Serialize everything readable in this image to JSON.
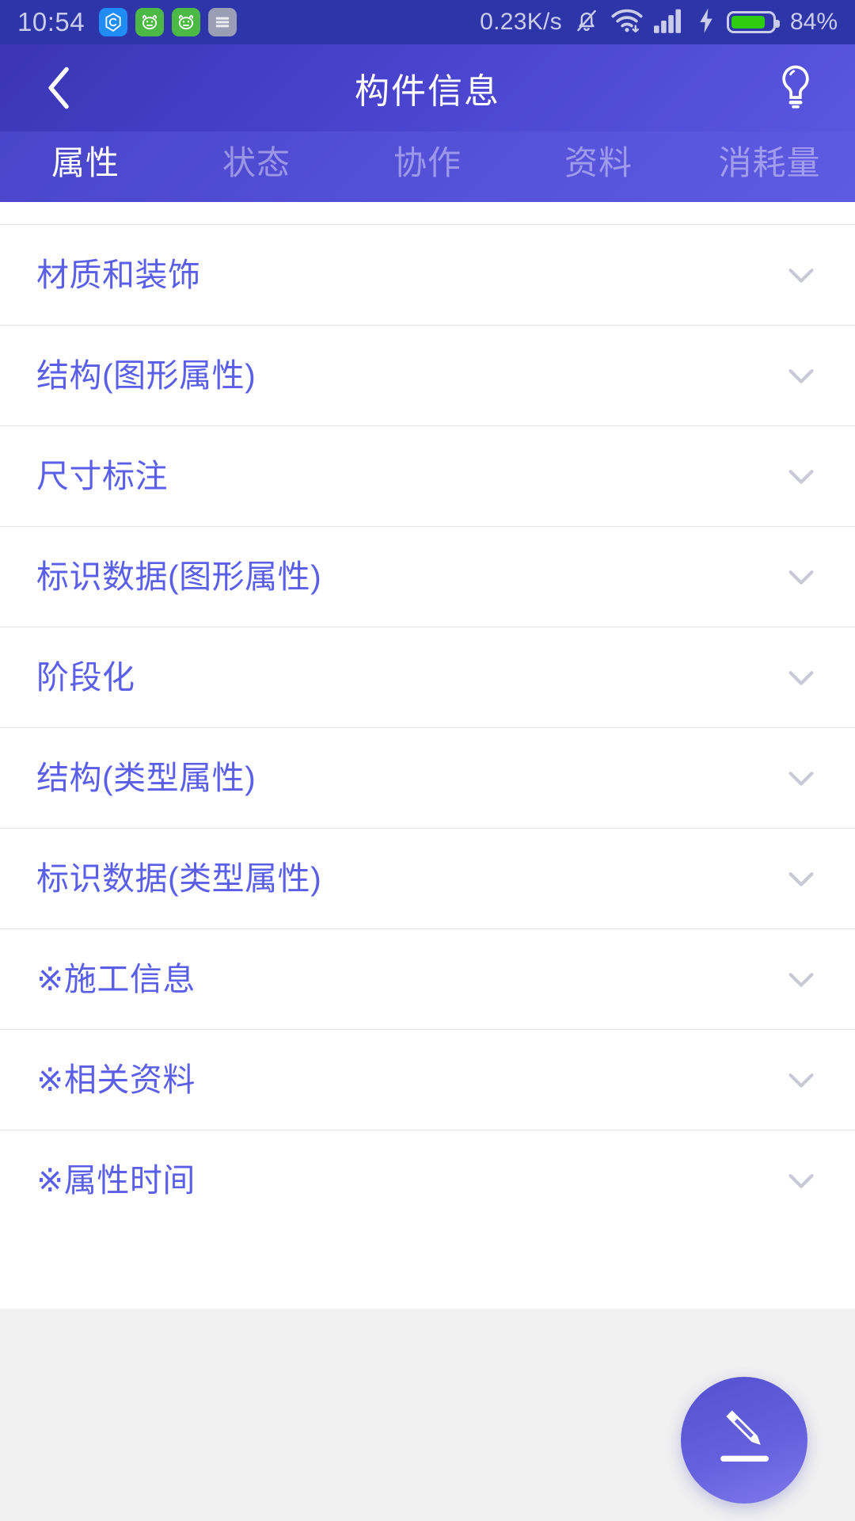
{
  "status_bar": {
    "time": "10:54",
    "network_speed": "0.23K/s",
    "battery_percent": "84%",
    "battery_level": 84,
    "app_icons": [
      {
        "name": "hexagon-app-icon",
        "color": "#1f8df5"
      },
      {
        "name": "frog-app-icon",
        "color": "#4cb944"
      },
      {
        "name": "frog-app-icon-2",
        "color": "#4cb944"
      },
      {
        "name": "list-app-icon",
        "color": "#9a9eb5"
      }
    ],
    "icons": [
      "mute-bell-icon",
      "wifi-icon",
      "cellular-signal-icon",
      "charging-bolt-icon",
      "battery-icon"
    ]
  },
  "header": {
    "title": "构件信息",
    "back_icon": "chevron-left-icon",
    "action_icon": "lightbulb-icon",
    "gradient_start": "#3b35b5",
    "gradient_end": "#5b56e0"
  },
  "tabs": {
    "active_index": 0,
    "items": [
      {
        "label": "属性"
      },
      {
        "label": "状态"
      },
      {
        "label": "协作"
      },
      {
        "label": "资料"
      },
      {
        "label": "消耗量"
      }
    ]
  },
  "list": {
    "accent_color": "#5b5fe8",
    "rows": [
      {
        "label": "材质和装饰"
      },
      {
        "label": "结构(图形属性)"
      },
      {
        "label": "尺寸标注"
      },
      {
        "label": "标识数据(图形属性)"
      },
      {
        "label": "阶段化"
      },
      {
        "label": "结构(类型属性)"
      },
      {
        "label": "标识数据(类型属性)"
      },
      {
        "label": "※施工信息"
      },
      {
        "label": "※相关资料"
      },
      {
        "label": "※属性时间"
      }
    ]
  },
  "fab": {
    "icon": "edit-pencil-icon",
    "gradient_start": "#5450cf",
    "gradient_end": "#7e79ea"
  }
}
